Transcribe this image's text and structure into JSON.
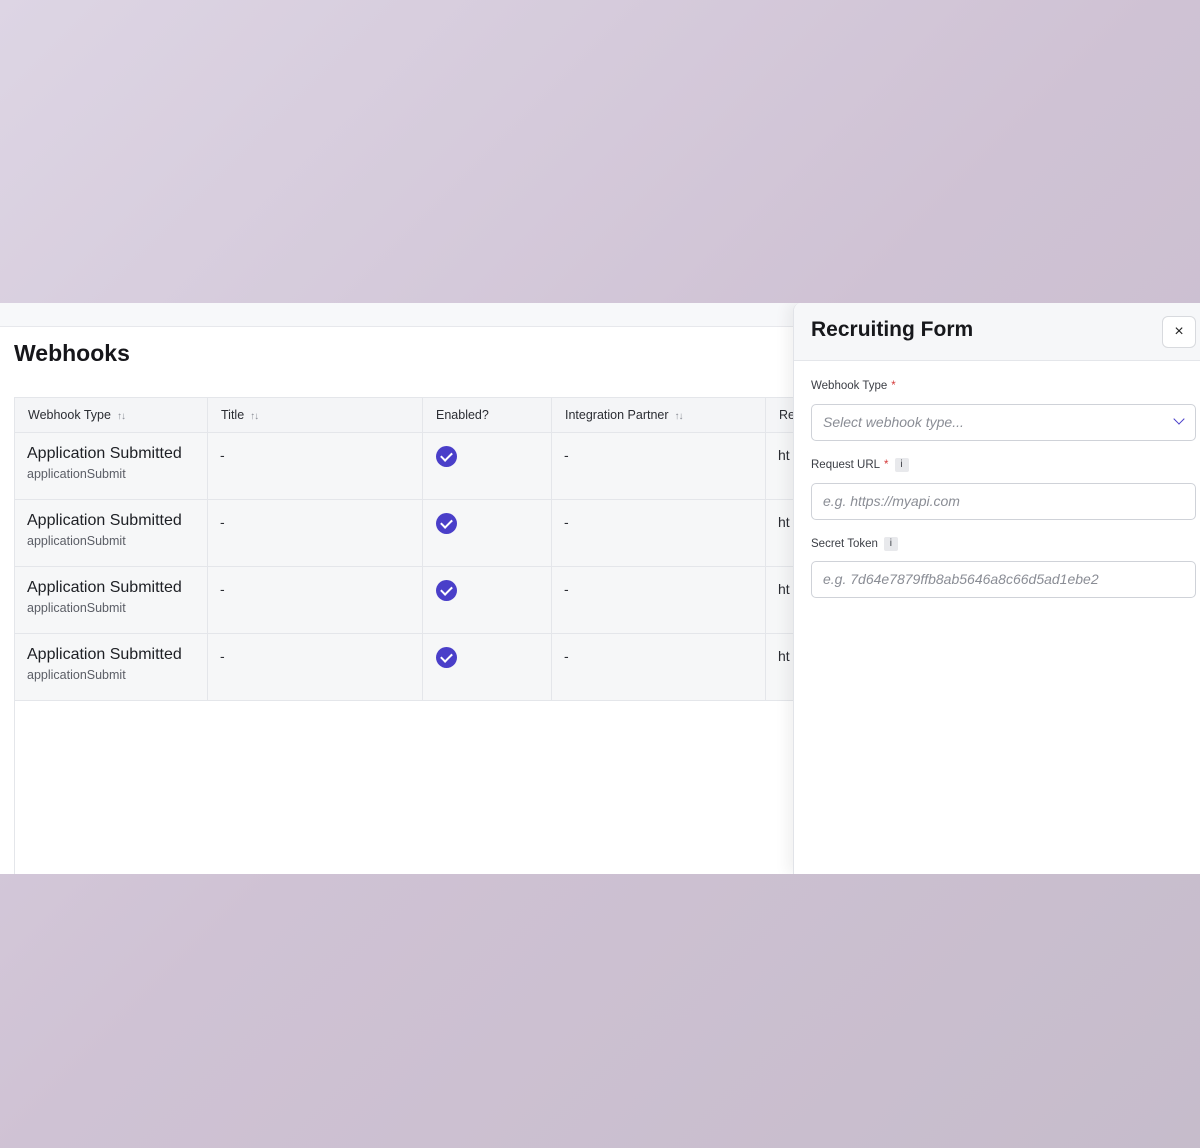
{
  "page": {
    "title": "Webhooks"
  },
  "table": {
    "columns": [
      {
        "label": "Webhook Type",
        "sortable": true
      },
      {
        "label": "Title",
        "sortable": true
      },
      {
        "label": "Enabled?",
        "sortable": false
      },
      {
        "label": "Integration Partner",
        "sortable": true
      },
      {
        "label": "Re",
        "sortable": false
      }
    ],
    "sort_glyph": "↑↓",
    "rows": [
      {
        "type": "Application Submitted",
        "type_key": "applicationSubmit",
        "title": "-",
        "enabled": true,
        "partner": "-",
        "url": "ht"
      },
      {
        "type": "Application Submitted",
        "type_key": "applicationSubmit",
        "title": "-",
        "enabled": true,
        "partner": "-",
        "url": "ht"
      },
      {
        "type": "Application Submitted",
        "type_key": "applicationSubmit",
        "title": "-",
        "enabled": true,
        "partner": "-",
        "url": "ht"
      },
      {
        "type": "Application Submitted",
        "type_key": "applicationSubmit",
        "title": "-",
        "enabled": true,
        "partner": "-",
        "url": "ht"
      }
    ]
  },
  "panel": {
    "title": "Recruiting Form",
    "close_label": "×",
    "fields": {
      "webhook_type": {
        "label": "Webhook Type",
        "required_mark": "*",
        "placeholder": "Select webhook type..."
      },
      "request_url": {
        "label": "Request URL",
        "required_mark": "*",
        "info": "i",
        "placeholder": "e.g. https://myapi.com"
      },
      "secret_token": {
        "label": "Secret Token",
        "info": "i",
        "placeholder": "e.g. 7d64e7879ffb8ab5646a8c66d5ad1ebe2"
      }
    }
  },
  "colors": {
    "accent": "#4a3fc9",
    "required": "#d43a3a"
  }
}
